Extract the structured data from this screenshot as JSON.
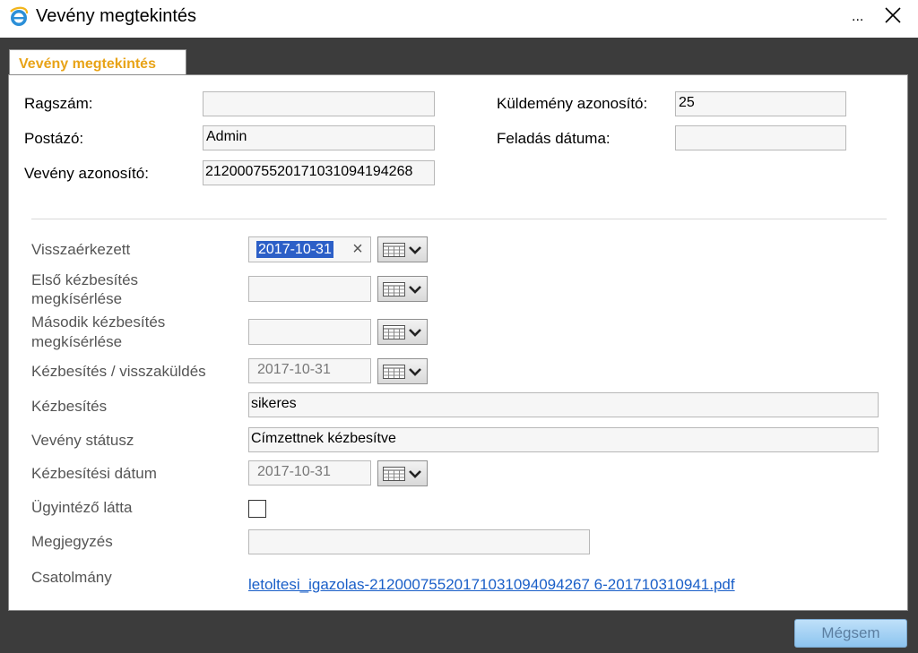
{
  "window": {
    "title": "Vevény megtekintés",
    "more_label": "...",
    "icons": {
      "app": "ie-icon",
      "close": "close-icon"
    }
  },
  "tab": {
    "label": "Vevény megtekintés"
  },
  "header_fields": {
    "ragszam": {
      "label": "Ragszám:",
      "value": ""
    },
    "postazo": {
      "label": "Postázó:",
      "value": "Admin"
    },
    "veveny_azonosito": {
      "label": "Vevény azonosító:",
      "value": "21200075520171031094194268"
    },
    "kuldemeny_azonosito": {
      "label": "Küldemény azonosító:",
      "value": "25"
    },
    "feladas_datuma": {
      "label": "Feladás dátuma:",
      "value": ""
    }
  },
  "details": {
    "visszaerkezett": {
      "label": "Visszaérkezett",
      "value": "2017-10-31",
      "clear_symbol": "×"
    },
    "elso_kezbesites": {
      "label_line1": "Első kézbesítés",
      "label_line2": "megkísérlése",
      "value": ""
    },
    "masodik_kezbesites": {
      "label_line1": "Második kézbesítés",
      "label_line2": "megkísérlése",
      "value": ""
    },
    "kezbesites_visszakuldes": {
      "label": "Kézbesítés / visszaküldés",
      "value": "2017-10-31"
    },
    "kezbesites": {
      "label": "Kézbesítés",
      "value": "sikeres"
    },
    "veveny_statusz": {
      "label": "Vevény státusz",
      "value": "Címzettnek kézbesítve"
    },
    "kezbesitesi_datum": {
      "label": "Kézbesítési dátum",
      "value": "2017-10-31"
    },
    "ugyintezo_latta": {
      "label": "Ügyintéző látta",
      "checked": false
    },
    "megjegyzes": {
      "label": "Megjegyzés",
      "value": ""
    },
    "csatolmany": {
      "label": "Csatolmány",
      "link_text": "letoltesi_igazolas-21200075520171031094094267 6-201710310941.pdf"
    }
  },
  "footer": {
    "cancel_label": "Mégsem"
  },
  "colors": {
    "tab_text": "#e8a317",
    "link": "#1a5fc8",
    "selection": "#2c5fc7",
    "button_bg": "#8cc4ef"
  }
}
